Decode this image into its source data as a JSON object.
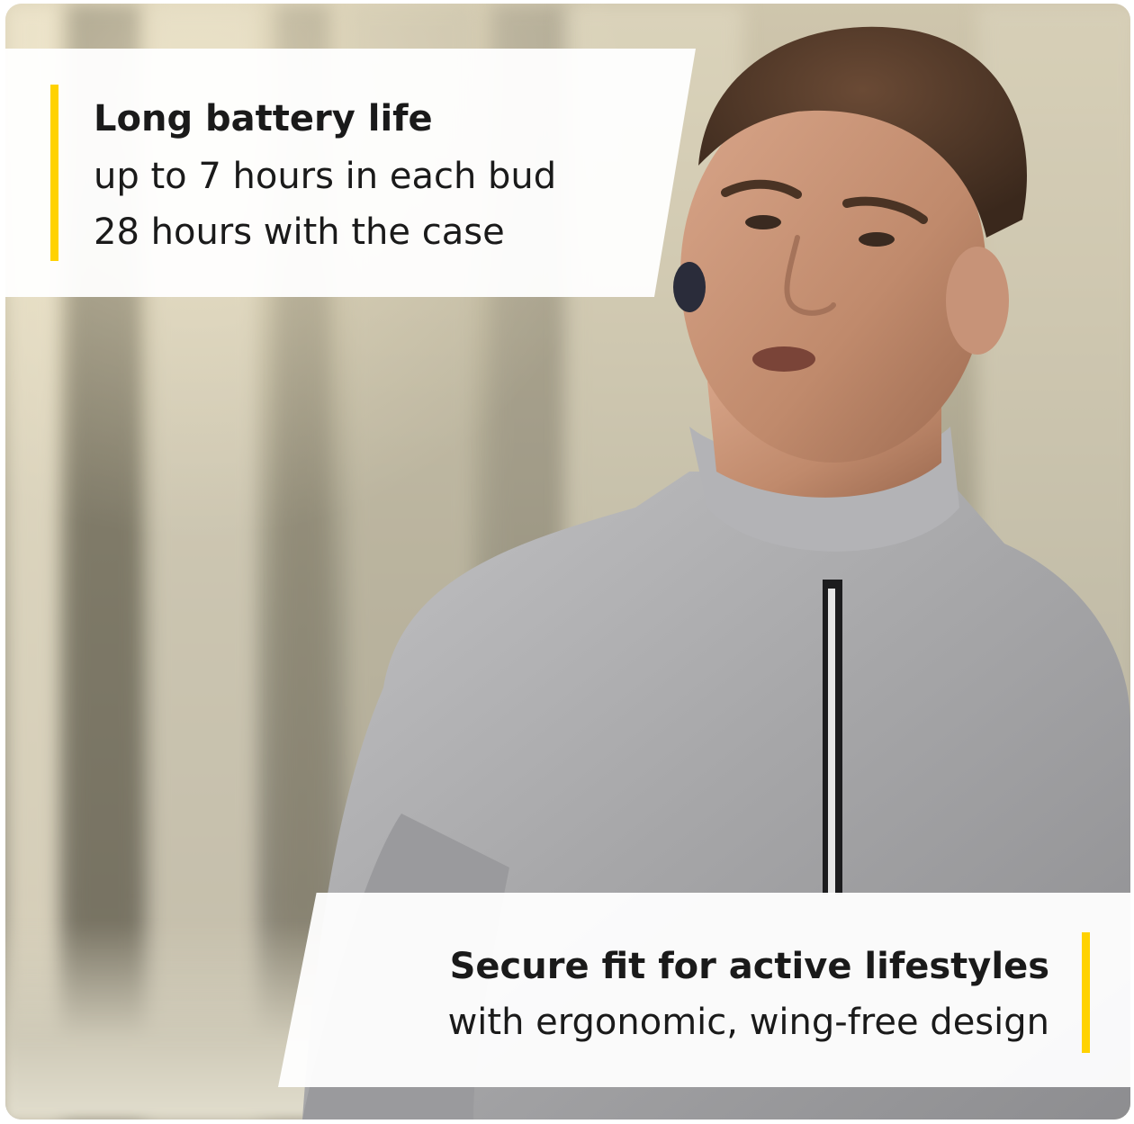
{
  "feature_top": {
    "headline": "Long battery life",
    "line1": "up to 7 hours in each bud",
    "line2": "28 hours with the case"
  },
  "feature_bottom": {
    "headline": "Secure fit for active lifestyles",
    "line1": "with ergonomic, wing-free design"
  },
  "colors": {
    "accent": "#ffd200",
    "panel": "#ffffff",
    "text": "#1a1a1a",
    "shirt": "#a9a9a9",
    "earbud": "#2a2c3a"
  }
}
